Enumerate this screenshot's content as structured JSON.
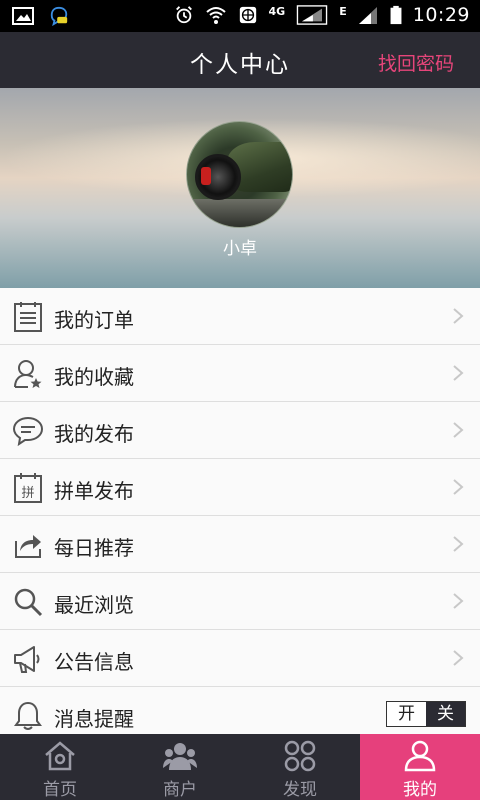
{
  "status_bar": {
    "time": "10:29",
    "network_label": "4G",
    "edge_label": "E"
  },
  "header": {
    "title": "个人中心",
    "action_label": "找回密码",
    "accent_color": "#e6457a"
  },
  "profile": {
    "username": "小卓"
  },
  "menu": {
    "items": [
      {
        "label": "我的订单",
        "icon": "order-list-icon"
      },
      {
        "label": "我的收藏",
        "icon": "favorite-user-star-icon"
      },
      {
        "label": "我的发布",
        "icon": "message-bubble-icon"
      },
      {
        "label": "拼单发布",
        "icon": "calendar-pin-icon",
        "icon_text": "拼"
      },
      {
        "label": "每日推荐",
        "icon": "share-icon"
      },
      {
        "label": "最近浏览",
        "icon": "search-icon"
      },
      {
        "label": "公告信息",
        "icon": "megaphone-icon"
      },
      {
        "label": "消息提醒",
        "icon": "bell-icon"
      }
    ],
    "notification_toggle": {
      "on_label": "开",
      "off_label": "关",
      "selected": "关"
    }
  },
  "tabbar": {
    "tabs": [
      {
        "label": "首页",
        "icon": "home-icon"
      },
      {
        "label": "商户",
        "icon": "merchants-icon"
      },
      {
        "label": "发现",
        "icon": "discover-icon"
      },
      {
        "label": "我的",
        "icon": "user-icon",
        "active": true
      }
    ],
    "active_color": "#e6407c"
  }
}
